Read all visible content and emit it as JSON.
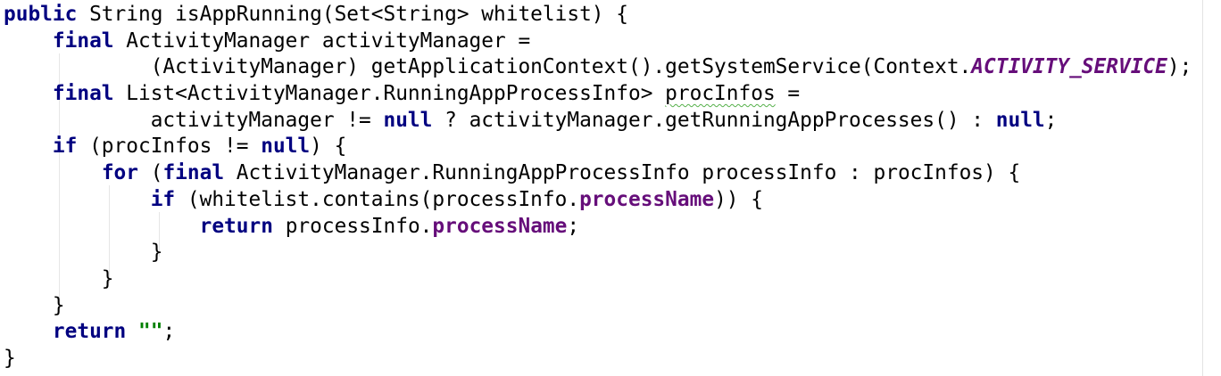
{
  "code": {
    "lines": [
      [
        {
          "t": "public",
          "c": "kw"
        },
        {
          "t": " String isAppRunning(Set<String> whitelist) {"
        }
      ],
      [
        {
          "t": "    "
        },
        {
          "t": "final",
          "c": "kw"
        },
        {
          "t": " ActivityManager activityManager ="
        }
      ],
      [
        {
          "t": "            (ActivityManager) getApplicationContext().getSystemService(Context."
        },
        {
          "t": "ACTIVITY_SERVICE",
          "c": "const"
        },
        {
          "t": ");"
        }
      ],
      [
        {
          "t": "    "
        },
        {
          "t": "final",
          "c": "kw"
        },
        {
          "t": " List<ActivityManager.RunningAppProcessInfo> "
        },
        {
          "t": "procInfos",
          "c": "typo"
        },
        {
          "t": " ="
        }
      ],
      [
        {
          "t": "            activityManager != "
        },
        {
          "t": "null",
          "c": "kw"
        },
        {
          "t": " ? activityManager.getRunningAppProcesses() : "
        },
        {
          "t": "null",
          "c": "kw"
        },
        {
          "t": ";"
        }
      ],
      [
        {
          "t": "    "
        },
        {
          "t": "if",
          "c": "kw"
        },
        {
          "t": " (procInfos != "
        },
        {
          "t": "null",
          "c": "kw"
        },
        {
          "t": ") {"
        }
      ],
      [
        {
          "t": "        "
        },
        {
          "t": "for",
          "c": "kw"
        },
        {
          "t": " ("
        },
        {
          "t": "final",
          "c": "kw"
        },
        {
          "t": " ActivityManager.RunningAppProcessInfo processInfo : procInfos) {"
        }
      ],
      [
        {
          "t": "            "
        },
        {
          "t": "if",
          "c": "kw"
        },
        {
          "t": " (whitelist.contains(processInfo."
        },
        {
          "t": "processName",
          "c": "field"
        },
        {
          "t": ")) {"
        }
      ],
      [
        {
          "t": "                "
        },
        {
          "t": "return",
          "c": "kw"
        },
        {
          "t": " processInfo."
        },
        {
          "t": "processName",
          "c": "field"
        },
        {
          "t": ";"
        }
      ],
      [
        {
          "t": "            }"
        }
      ],
      [
        {
          "t": "        }"
        }
      ],
      [
        {
          "t": "    }"
        }
      ],
      [
        {
          "t": "    "
        },
        {
          "t": "return",
          "c": "kw"
        },
        {
          "t": " "
        },
        {
          "t": "\"\"",
          "c": "str"
        },
        {
          "t": ";"
        }
      ],
      [
        {
          "t": "}"
        }
      ]
    ]
  }
}
